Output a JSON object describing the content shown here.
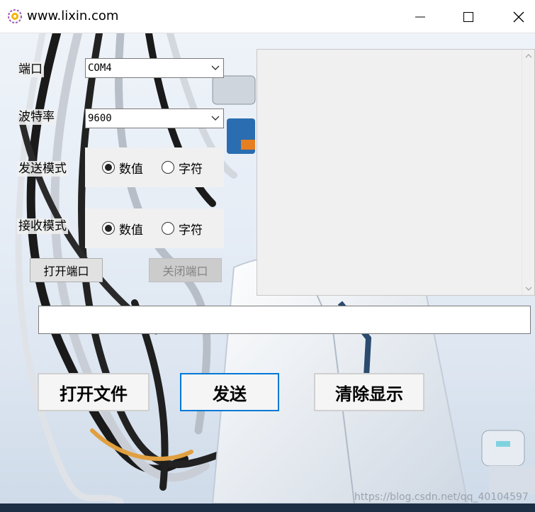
{
  "window": {
    "title": "www.lixin.com"
  },
  "form": {
    "port": {
      "label": "端口",
      "value": "COM4"
    },
    "baud": {
      "label": "波特率",
      "value": "9600"
    },
    "send_mode": {
      "label": "发送模式",
      "options": [
        "数值",
        "字符"
      ],
      "selected": "数值"
    },
    "recv_mode": {
      "label": "接收模式",
      "options": [
        "数值",
        "字符"
      ],
      "selected": "数值"
    },
    "open_port_label": "打开端口",
    "close_port_label": "关闭端口"
  },
  "receive_display": {
    "text": ""
  },
  "send_input": {
    "value": ""
  },
  "actions": {
    "open_file_label": "打开文件",
    "send_label": "发送",
    "clear_label": "清除显示"
  },
  "watermark": "https://blog.csdn.net/qq_40104597",
  "colors": {
    "focus": "#0078d7",
    "taskbar": "#1c2f45"
  }
}
